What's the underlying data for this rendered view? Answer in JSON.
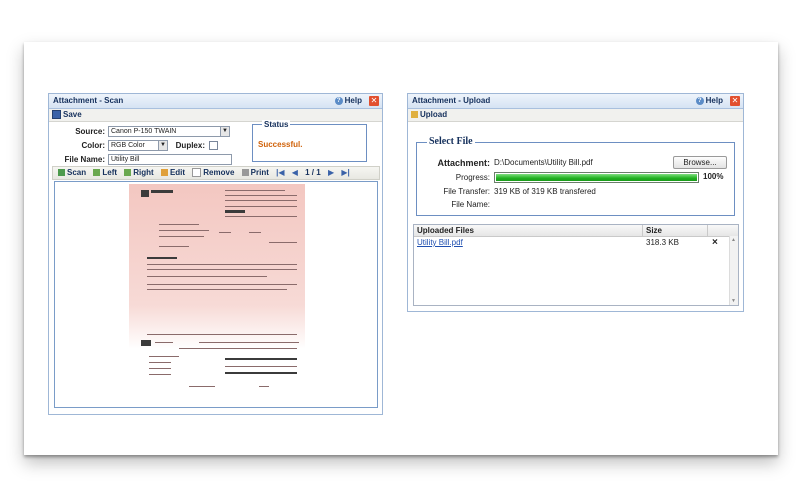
{
  "scan": {
    "title": "Attachment - Scan",
    "help_label": "Help",
    "close_glyph": "✕",
    "toolbar": {
      "save_label": "Save"
    },
    "source_label": "Source:",
    "source_value": "Canon P-150 TWAIN",
    "color_label": "Color:",
    "color_value": "RGB Color",
    "duplex_label": "Duplex:",
    "filename_label": "File Name:",
    "filename_value": "Utility Bill",
    "status_legend": "Status",
    "status_text": "Successful.",
    "nav": {
      "scan": "Scan",
      "left": "Left",
      "right": "Right",
      "edit": "Edit",
      "remove": "Remove",
      "print": "Print",
      "page": "1 / 1"
    }
  },
  "upload": {
    "title": "Attachment - Upload",
    "help_label": "Help",
    "close_glyph": "✕",
    "toolbar": {
      "upload_label": "Upload"
    },
    "legend": "Select File",
    "attachment_label": "Attachment:",
    "attachment_value": "D:\\Documents\\Utility Bill.pdf",
    "browse_label": "Browse...",
    "progress_label": "Progress:",
    "progress_fraction": 1.0,
    "progress_text": "100%",
    "transfer_label": "File Transfer:",
    "transfer_value": "319 KB of 319 KB transfered",
    "filename_label": "File Name:",
    "grid": {
      "headers": [
        "Uploaded Files",
        "Size"
      ],
      "rows": [
        {
          "name": "Utility Bill.pdf",
          "size": "318.3 KB",
          "remove": "×"
        }
      ]
    }
  },
  "colors": {
    "accent": "#15305c",
    "status": "#d0620a",
    "link": "#1f4fb0",
    "progress": "#21b021"
  }
}
